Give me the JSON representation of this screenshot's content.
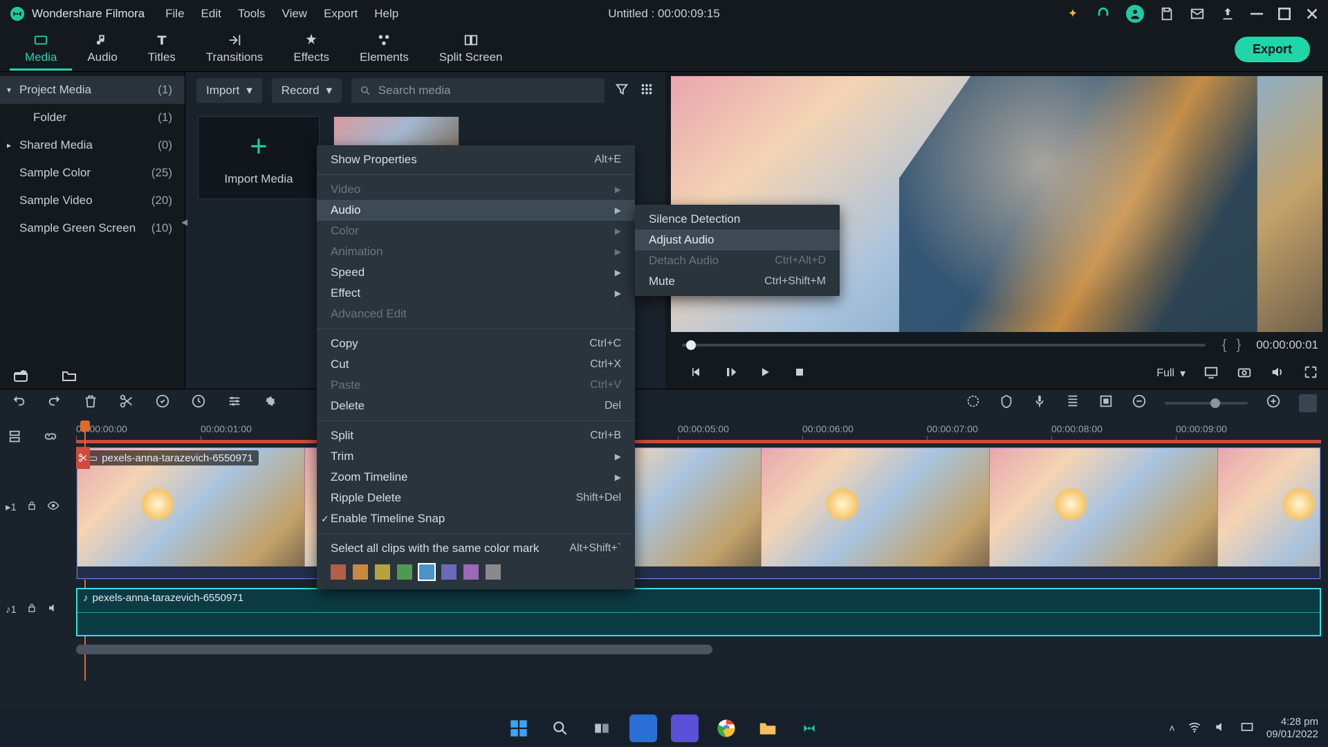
{
  "app_name": "Wondershare Filmora",
  "menu": [
    "File",
    "Edit",
    "Tools",
    "View",
    "Export",
    "Help"
  ],
  "doc_title": "Untitled : 00:00:09:15",
  "workspace_tabs": [
    {
      "label": "Media",
      "active": true
    },
    {
      "label": "Audio"
    },
    {
      "label": "Titles"
    },
    {
      "label": "Transitions"
    },
    {
      "label": "Effects"
    },
    {
      "label": "Elements"
    },
    {
      "label": "Split Screen"
    }
  ],
  "export_label": "Export",
  "sidebar": [
    {
      "label": "Project Media",
      "count": "(1)",
      "caret": "▾",
      "sel": true,
      "indent": 0
    },
    {
      "label": "Folder",
      "count": "(1)",
      "indent": 1
    },
    {
      "label": "Shared Media",
      "count": "(0)",
      "caret": "▸",
      "indent": 0
    },
    {
      "label": "Sample Color",
      "count": "(25)",
      "indent": 0
    },
    {
      "label": "Sample Video",
      "count": "(20)",
      "indent": 0
    },
    {
      "label": "Sample Green Screen",
      "count": "(10)",
      "indent": 0
    }
  ],
  "media_toolbar": {
    "import": "Import",
    "record": "Record",
    "search_placeholder": "Search media"
  },
  "import_thumb_label": "Import Media",
  "preview": {
    "brace_open": "{",
    "brace_close": "}",
    "timecode": "00:00:00:01",
    "quality": "Full"
  },
  "timeline": {
    "ticks": [
      "00:00:00:00",
      "00:00:01:00",
      "",
      "",
      "00:00:05:00",
      "00:00:06:00",
      "00:00:07:00",
      "00:00:08:00",
      "00:00:09:00"
    ],
    "video_clip": "pexels-anna-tarazevich-6550971",
    "audio_clip": "pexels-anna-tarazevich-6550971",
    "video_track_label": "1",
    "audio_track_label": "1"
  },
  "context_main": [
    {
      "label": "Show Properties",
      "sc": "Alt+E"
    },
    {
      "sep": true
    },
    {
      "label": "Video",
      "arrow": true,
      "disabled": true
    },
    {
      "label": "Audio",
      "arrow": true,
      "hl": true
    },
    {
      "label": "Color",
      "arrow": true,
      "disabled": true
    },
    {
      "label": "Animation",
      "arrow": true,
      "disabled": true
    },
    {
      "label": "Speed",
      "arrow": true
    },
    {
      "label": "Effect",
      "arrow": true
    },
    {
      "label": "Advanced Edit",
      "disabled": true
    },
    {
      "sep": true
    },
    {
      "label": "Copy",
      "sc": "Ctrl+C"
    },
    {
      "label": "Cut",
      "sc": "Ctrl+X"
    },
    {
      "label": "Paste",
      "sc": "Ctrl+V",
      "disabled": true
    },
    {
      "label": "Delete",
      "sc": "Del"
    },
    {
      "sep": true
    },
    {
      "label": "Split",
      "sc": "Ctrl+B"
    },
    {
      "label": "Trim",
      "arrow": true
    },
    {
      "label": "Zoom Timeline",
      "arrow": true
    },
    {
      "label": "Ripple Delete",
      "sc": "Shift+Del"
    },
    {
      "label": "Enable Timeline Snap",
      "check": true
    },
    {
      "sep": true
    },
    {
      "label": "Select all clips with the same color mark",
      "sc": "Alt+Shift+`"
    }
  ],
  "context_colors": [
    "#b06048",
    "#c8893e",
    "#b8a23e",
    "#4e9a52",
    "#4a94c8",
    "#6a6ab8",
    "#9a6ab8",
    "#8a8a8a"
  ],
  "context_color_sel": 4,
  "context_sub": [
    {
      "label": "Silence Detection"
    },
    {
      "label": "Adjust Audio",
      "hl": true
    },
    {
      "label": "Detach Audio",
      "sc": "Ctrl+Alt+D",
      "disabled": true
    },
    {
      "label": "Mute",
      "sc": "Ctrl+Shift+M"
    }
  ],
  "taskbar": {
    "time": "4:28 pm",
    "date": "09/01/2022"
  }
}
